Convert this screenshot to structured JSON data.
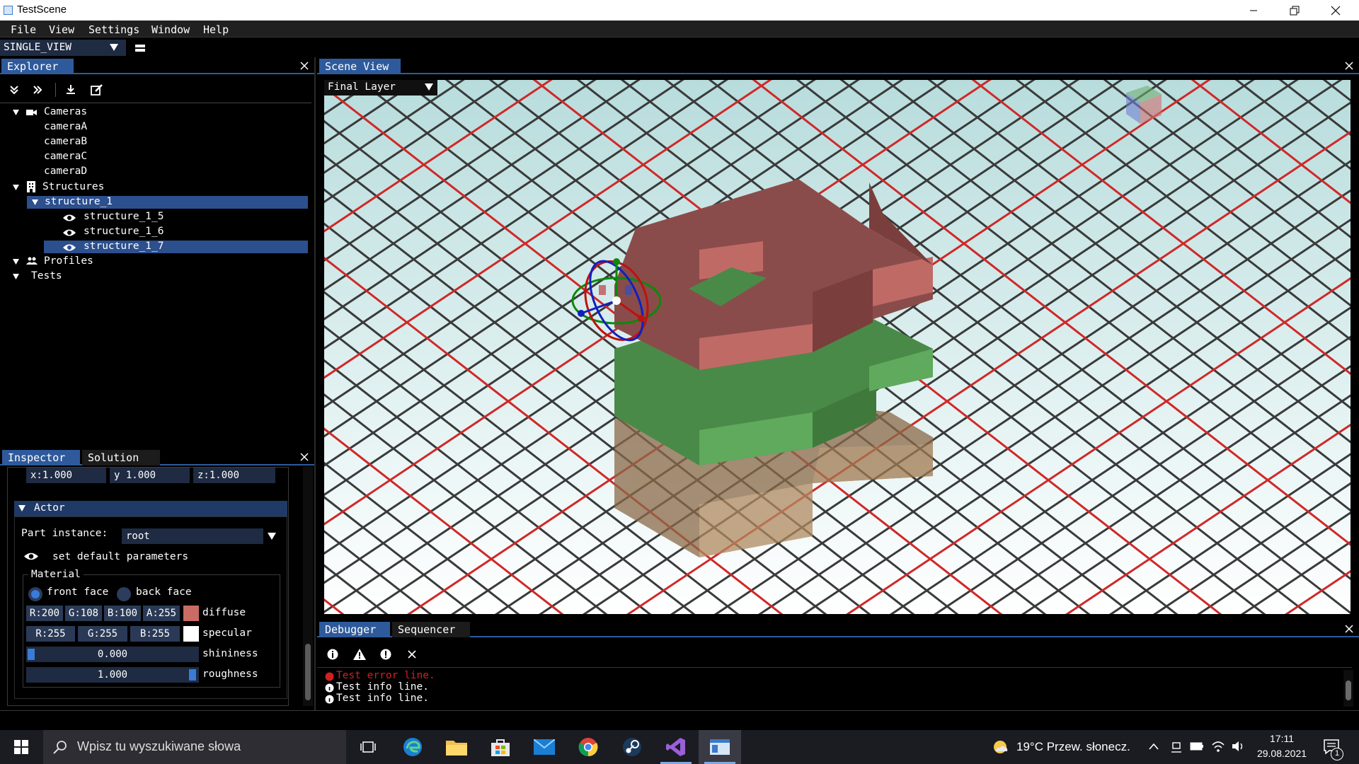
{
  "window": {
    "title": "TestScene"
  },
  "menubar": {
    "items": [
      "File",
      "View",
      "Settings",
      "Window",
      "Help"
    ]
  },
  "viewbar": {
    "layout_value": "SINGLE_VIEW"
  },
  "explorer": {
    "tab": "Explorer",
    "tree": {
      "cameras": "Cameras",
      "camera_items": [
        "cameraA",
        "cameraB",
        "cameraC",
        "cameraD"
      ],
      "structures": "Structures",
      "structure_1": "structure_1",
      "structure_children": [
        "structure_1_5",
        "structure_1_6",
        "structure_1_7"
      ],
      "profiles": "Profiles",
      "tests": "Tests"
    }
  },
  "inspector": {
    "tabs": [
      "Inspector",
      "Solution"
    ],
    "scale": {
      "x": "x:1.000",
      "y": "y 1.000",
      "z": "z:1.000"
    },
    "actor_header": "Actor",
    "part_instance_label": "Part instance:",
    "part_instance_value": "root",
    "set_default": "set default parameters",
    "material_label": "Material",
    "front_face": "front face",
    "back_face": "back face",
    "diffuse": {
      "r": "R:200",
      "g": "G:108",
      "b": "B:100",
      "a": "A:255",
      "label": "diffuse",
      "color": "#c86c64"
    },
    "specular": {
      "r": "R:255",
      "g": "G:255",
      "b": "B:255",
      "label": "specular",
      "color": "#ffffff"
    },
    "shininess": {
      "value": "0.000",
      "label": "shininess",
      "fraction": 0.0
    },
    "roughness": {
      "value": "1.000",
      "label": "roughness",
      "fraction": 1.0
    }
  },
  "scene": {
    "tab": "Scene View",
    "layer_value": "Final Layer"
  },
  "debugger": {
    "tabs": [
      "Debugger",
      "Sequencer"
    ],
    "logs": [
      {
        "text": "Test error line.",
        "level": "error"
      },
      {
        "text": "Test info line.",
        "level": "info"
      },
      {
        "text": "Test info line.",
        "level": "info"
      }
    ]
  },
  "taskbar": {
    "search_placeholder": "Wpisz tu wyszukiwane słowa",
    "weather": "19°C  Przew. słonecz.",
    "time": "17:11",
    "date": "29.08.2021",
    "notification_count": "1"
  },
  "colors": {
    "accent": "#2e5a9c",
    "selection": "#2c4f8e",
    "error": "#d02020"
  }
}
